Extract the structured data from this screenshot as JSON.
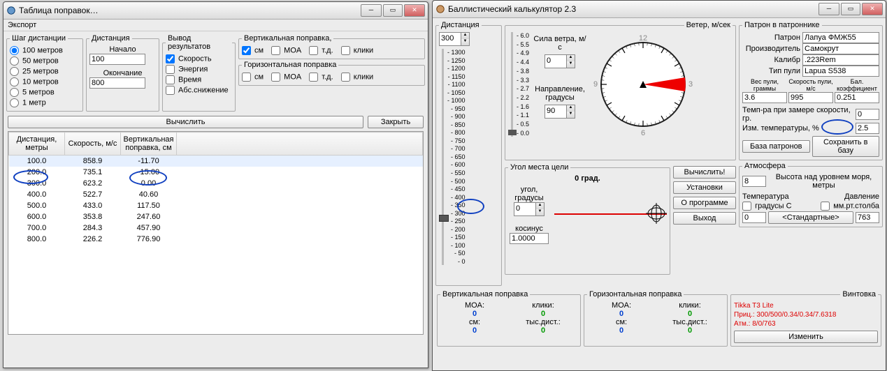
{
  "left": {
    "title": "Таблица поправок…",
    "menu": "Экспорт",
    "step": {
      "legend": "Шаг дистанции",
      "opts": [
        "100 метров",
        "50 метров",
        "25 метров",
        "10 метров",
        "5 метров",
        "1 метр"
      ],
      "selected": 0
    },
    "dist": {
      "legend": "Дистанция",
      "start_lbl": "Начало",
      "start_val": "100",
      "end_lbl": "Окончание",
      "end_val": "800"
    },
    "out": {
      "legend": "Вывод результатов",
      "opts": [
        "Скорость",
        "Энергия",
        "Время",
        "Абс.снижение"
      ],
      "vert": {
        "legend": "Вертикальная поправка,",
        "units": [
          "см",
          "MOA",
          "т.д.",
          "клики"
        ]
      },
      "horz": {
        "legend": "Горизонтальная поправка",
        "units": [
          "см",
          "MOA",
          "т.д.",
          "клики"
        ]
      }
    },
    "calc_btn": "Вычислить",
    "close_btn": "Закрыть",
    "table": {
      "headers": [
        "Дистанция, метры",
        "Скорость, м/с",
        "Вертикальная поправка, см"
      ],
      "rows": [
        [
          "100.0",
          "858.9",
          "-11.70"
        ],
        [
          "200.0",
          "735.1",
          "-15.00"
        ],
        [
          "300.0",
          "623.2",
          "0.00"
        ],
        [
          "400.0",
          "522.7",
          "40.60"
        ],
        [
          "500.0",
          "433.0",
          "117.50"
        ],
        [
          "600.0",
          "353.8",
          "247.60"
        ],
        [
          "700.0",
          "284.3",
          "457.90"
        ],
        [
          "800.0",
          "226.2",
          "776.90"
        ]
      ]
    }
  },
  "right": {
    "title": "Баллистический калькулятор 2.3",
    "dist": {
      "legend": "Дистанция",
      "val": "300",
      "ticks": [
        "- 1300",
        "- 1250",
        "- 1200",
        "- 1150",
        "- 1100",
        "- 1050",
        "- 1000",
        "- 950",
        "- 900",
        "- 850",
        "- 800",
        "- 750",
        "- 700",
        "- 650",
        "- 600",
        "- 550",
        "- 500",
        "- 450",
        "- 400",
        "- 350",
        "- 300",
        "- 250",
        "- 200",
        "- 150",
        "- 100",
        "- 50",
        "- 0"
      ]
    },
    "wind": {
      "legend": "Ветер, м/сек",
      "strength_lbl": "Сила ветра, м/с",
      "strength_val": "0",
      "dir_lbl": "Направление, градусы",
      "dir_val": "90",
      "scale": [
        "- 6.0",
        "- 5.5",
        "- 4.9",
        "- 4.4",
        "- 3.8",
        "- 3.3",
        "- 2.7",
        "- 2.2",
        "- 1.6",
        "- 1.1",
        "- 0.5",
        "- 0.0"
      ],
      "clock": [
        "12",
        "3",
        "6",
        "9"
      ]
    },
    "angle": {
      "legend": "Угол места цели",
      "deg": "0 град.",
      "deg_lbl": "угол, градусы",
      "deg_val": "0",
      "cos_lbl": "косинус",
      "cos_val": "1.0000"
    },
    "cart": {
      "legend": "Патрон в патроннике",
      "f": [
        {
          "l": "Патрон",
          "v": "Лапуа ФМЖ55"
        },
        {
          "l": "Производитель",
          "v": "Самокрут"
        },
        {
          "l": "Калибр",
          "v": ".223Rem"
        },
        {
          "l": "Тип пули",
          "v": "Lapua S538"
        }
      ],
      "h": [
        "Вес пули, граммы",
        "Скорость пули, м/с",
        "Бал. коэффициент"
      ],
      "hv": [
        "3.6",
        "995",
        "0.251"
      ],
      "temp_lbl": "Темп-ра при замере скорости, гр.",
      "temp_val": "0",
      "dt_lbl": "Изм. температуры, %",
      "dt_val": "2.5",
      "db_btn": "База патронов",
      "save_btn": "Сохранить в базу"
    },
    "atm": {
      "legend": "Атмосфера",
      "alt_lbl": "Высота над уровнем моря, метры",
      "alt_val": "8",
      "t_lbl": "Температура",
      "p_lbl": "Давление",
      "t_ck": "градусы C",
      "p_ck": "мм.рт.столба",
      "t_val": "0",
      "std_btn": "<Стандартные>",
      "p_val": "763"
    },
    "rifle": {
      "legend": "Винтовка",
      "lines": [
        "Tikka T3 Lite",
        "Приц.: 300/500/0.34/0.34/7.6318",
        "Атм.: 8/0/763"
      ],
      "btn": "Изменить"
    },
    "corr": {
      "v": {
        "legend": "Вертикальная поправка",
        "moa_l": "MOA:",
        "moa_v": "0",
        "cl_l": "клики:",
        "cl_v": "0",
        "cm_l": "см:",
        "cm_v": "0",
        "td_l": "тыс.дист.:",
        "td_v": "0"
      },
      "h": {
        "legend": "Горизонтальная поправка",
        "moa_l": "MOA:",
        "moa_v": "0",
        "cl_l": "клики:",
        "cl_v": "0",
        "cm_l": "см:",
        "cm_v": "0",
        "td_l": "тыс.дист.:",
        "td_v": "0"
      }
    },
    "btns": {
      "calc": "Вычислить!",
      "set": "Установки",
      "about": "О программе",
      "exit": "Выход"
    }
  }
}
